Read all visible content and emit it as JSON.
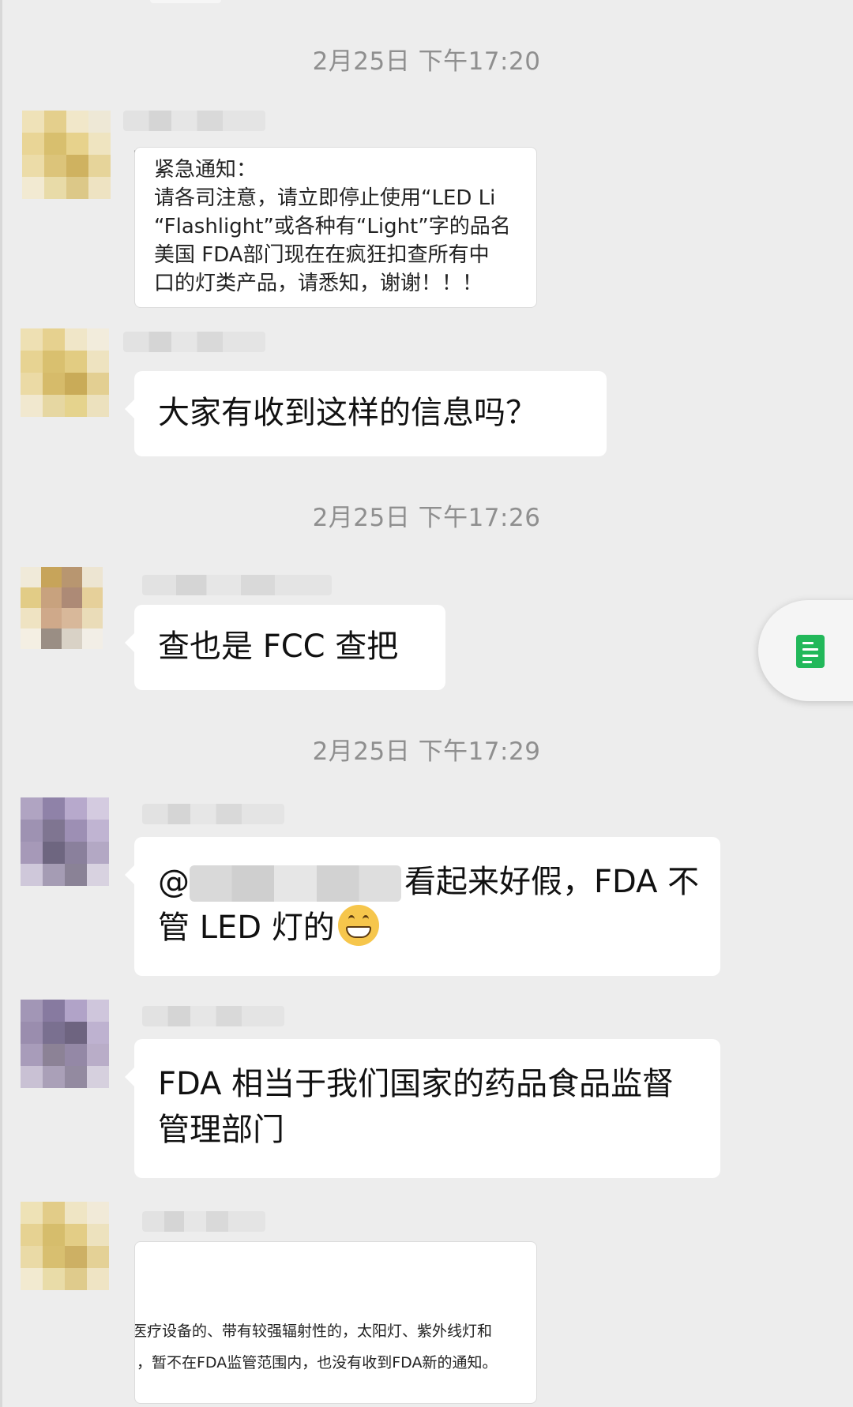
{
  "timestamps": [
    "2月25日 下午17:20",
    "2月25日 下午17:26",
    "2月25日 下午17:29"
  ],
  "messages": {
    "m1_lines": [
      "紧急通知：",
      "请各司注意，请立即停止使用“LED Li",
      "“Flashlight”或各种有“Light”字的品名",
      "美国 FDA部门现在在疯狂扣查所有中",
      "口的灯类产品，请悉知，谢谢！！！"
    ],
    "m2": "大家有收到这样的信息吗？",
    "m3": "查也是 FCC 查把",
    "m4_at": "@",
    "m4_line1": "看起来好假，FDA 不",
    "m4_line2": "管 LED 灯的",
    "m5": "FDA 相当于我们国家的药品食品监督管理部门",
    "m6_lines": [
      "医疗设备的、带有较强辐射性的，太阳灯、紫外线灯和",
      "，暂不在FDA监管范围内，也没有收到FDA新的通知。"
    ]
  },
  "float_button": {
    "icon": "document-icon"
  },
  "colors": {
    "background": "#ededed",
    "bubble": "#ffffff",
    "timestamp": "#8f8f8f",
    "doc_green": "#22b85a"
  }
}
